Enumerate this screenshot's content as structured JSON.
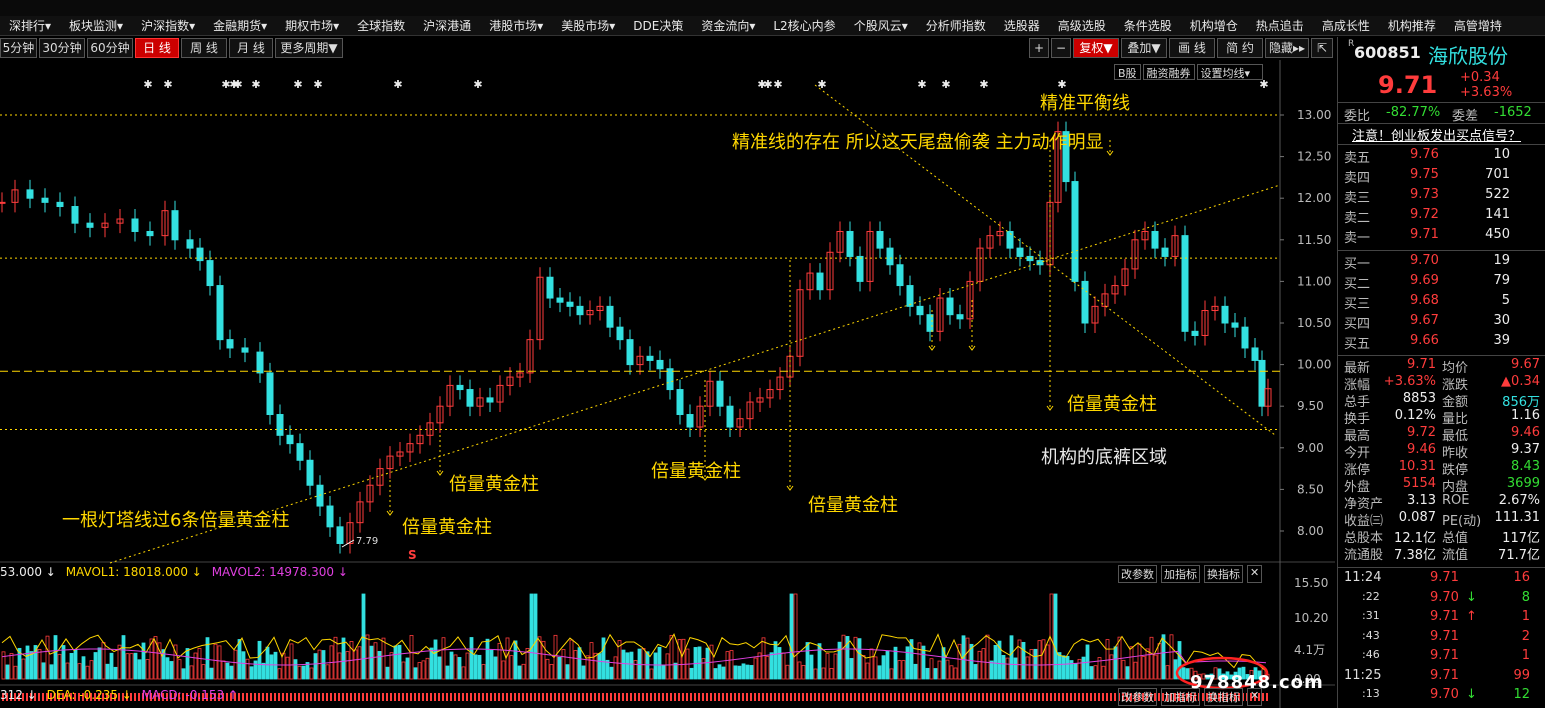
{
  "top_strip": "",
  "menu": [
    "深排行▾",
    "板块监测▾",
    "沪深指数▾",
    "金融期货▾",
    "期权市场▾",
    "全球指数",
    "沪深港通",
    "港股市场▾",
    "美股市场▾",
    "DDE决策",
    "资金流向▾",
    "L2核心内参",
    "个股风云▾",
    "分析师指数",
    "选股器",
    "高级选股",
    "条件选股",
    "机构增仓",
    "热点追击",
    "高成长性",
    "机构推荐",
    "高管增持"
  ],
  "periods": [
    "5分钟",
    "30分钟",
    "60分钟",
    "日 线",
    "周 线",
    "月 线",
    "更多周期▼"
  ],
  "active_period": "日 线",
  "right_tools": {
    "plus": "+",
    "minus": "−",
    "fuquan": "复权▼",
    "overlay": "叠加▼",
    "draw": "画 线",
    "about": "简 约",
    "hide": "隐藏▸▸"
  },
  "sub_tools": {
    "b_share": "B股",
    "margin": "融资融券",
    "ma_set": "设置均线▾"
  },
  "price_axis": [
    "13.00",
    "12.50",
    "12.00",
    "11.50",
    "11.00",
    "10.50",
    "10.00",
    "9.50",
    "9.00",
    "8.50",
    "8.00"
  ],
  "vol_axis": [
    "15.50",
    "10.20",
    "4.1万",
    "0.00"
  ],
  "macd_axis": [
    "0.00",
    "-0.44"
  ],
  "low_label": "7.79",
  "s_marker": "S",
  "vol_legend": {
    "v": "53.000 ↓",
    "mavol1": "MAVOL1: 18018.000 ↓",
    "mavol2": "MAVOL2: 14978.300 ↓"
  },
  "macd_legend": {
    "v": "312 ↓",
    "dea": "DEA: -0.235 ↓",
    "macd": "MACD: -0.153 ↑"
  },
  "panel_btns": {
    "param": "改参数",
    "add": "加指标",
    "swap": "换指标",
    "close": "✕"
  },
  "annotations": {
    "balance": "精准平衡线",
    "main": "精准线的存在 所以这天尾盘偷袭 主力动作明显",
    "g1": "倍量黄金柱",
    "g2": "倍量黄金柱",
    "g3": "倍量黄金柱",
    "g4": "倍量黄金柱",
    "g5": "倍量黄金柱",
    "lighthouse": "一根灯塔线过6条倍量黄金柱",
    "bottom": "机构的底裤区域"
  },
  "watermark": "978848.com",
  "colors": {
    "up": "#ff3c3c",
    "down": "#33e0e0",
    "dashed": "#ffd700",
    "accent": "#cc0000"
  },
  "quote": {
    "code_prefix": "R",
    "code": "600851",
    "name": "海欣股份",
    "price": "9.71",
    "change": "+0.34",
    "change_pct": "+3.63%",
    "weibi_label": "委比",
    "weibi": "-82.77%",
    "weicha_label": "委差",
    "weicha": "-1652",
    "notice": "注意！创业板发出买点信号？",
    "asks": [
      {
        "label": "卖五",
        "price": "9.76",
        "vol": "10"
      },
      {
        "label": "卖四",
        "price": "9.75",
        "vol": "701"
      },
      {
        "label": "卖三",
        "price": "9.73",
        "vol": "522"
      },
      {
        "label": "卖二",
        "price": "9.72",
        "vol": "141"
      },
      {
        "label": "卖一",
        "price": "9.71",
        "vol": "450"
      }
    ],
    "bids": [
      {
        "label": "买一",
        "price": "9.70",
        "vol": "19"
      },
      {
        "label": "买二",
        "price": "9.69",
        "vol": "79"
      },
      {
        "label": "买三",
        "price": "9.68",
        "vol": "5"
      },
      {
        "label": "买四",
        "price": "9.67",
        "vol": "30"
      },
      {
        "label": "买五",
        "price": "9.66",
        "vol": "39"
      }
    ],
    "stats": [
      {
        "l1": "最新",
        "v1": "9.71",
        "c1": "red",
        "l2": "均价",
        "v2": "9.67",
        "c2": "red"
      },
      {
        "l1": "涨幅",
        "v1": "+3.63%",
        "c1": "red",
        "l2": "涨跌",
        "v2": "▲0.34",
        "c2": "red"
      },
      {
        "l1": "总手",
        "v1": "8853",
        "c1": "wht",
        "l2": "金额",
        "v2": "856万",
        "c2": "cyn"
      },
      {
        "l1": "换手",
        "v1": "0.12%",
        "c1": "wht",
        "l2": "量比",
        "v2": "1.16",
        "c2": "wht"
      },
      {
        "l1": "最高",
        "v1": "9.72",
        "c1": "red",
        "l2": "最低",
        "v2": "9.46",
        "c2": "red"
      },
      {
        "l1": "今开",
        "v1": "9.46",
        "c1": "red",
        "l2": "昨收",
        "v2": "9.37",
        "c2": "wht"
      },
      {
        "l1": "涨停",
        "v1": "10.31",
        "c1": "red",
        "l2": "跌停",
        "v2": "8.43",
        "c2": "grn"
      },
      {
        "l1": "外盘",
        "v1": "5154",
        "c1": "red",
        "l2": "内盘",
        "v2": "3699",
        "c2": "grn"
      },
      {
        "l1": "净资产",
        "v1": "3.13",
        "c1": "wht",
        "l2": "ROE",
        "v2": "2.67%",
        "c2": "wht"
      },
      {
        "l1": "收益㈢",
        "v1": "0.087",
        "c1": "wht",
        "l2": "PE(动)",
        "v2": "111.31",
        "c2": "wht"
      },
      {
        "l1": "总股本",
        "v1": "12.1亿",
        "c1": "wht",
        "l2": "总值",
        "v2": "117亿",
        "c2": "wht"
      },
      {
        "l1": "流通股",
        "v1": "7.38亿",
        "c1": "wht",
        "l2": "流值",
        "v2": "71.7亿",
        "c2": "wht"
      }
    ],
    "ticks": [
      {
        "t": "11:24",
        "p": "9.71",
        "arrow": "",
        "v": "16"
      },
      {
        "t": ":22",
        "p": "9.70",
        "arrow": "↓",
        "v": "8"
      },
      {
        "t": ":31",
        "p": "9.71",
        "arrow": "↑",
        "v": "1"
      },
      {
        "t": ":43",
        "p": "9.71",
        "arrow": "",
        "v": "2"
      },
      {
        "t": ":46",
        "p": "9.71",
        "arrow": "",
        "v": "1"
      },
      {
        "t": "11:25",
        "p": "9.71",
        "arrow": "",
        "v": "99"
      },
      {
        "t": ":13",
        "p": "9.70",
        "arrow": "↓",
        "v": "12"
      }
    ]
  }
}
